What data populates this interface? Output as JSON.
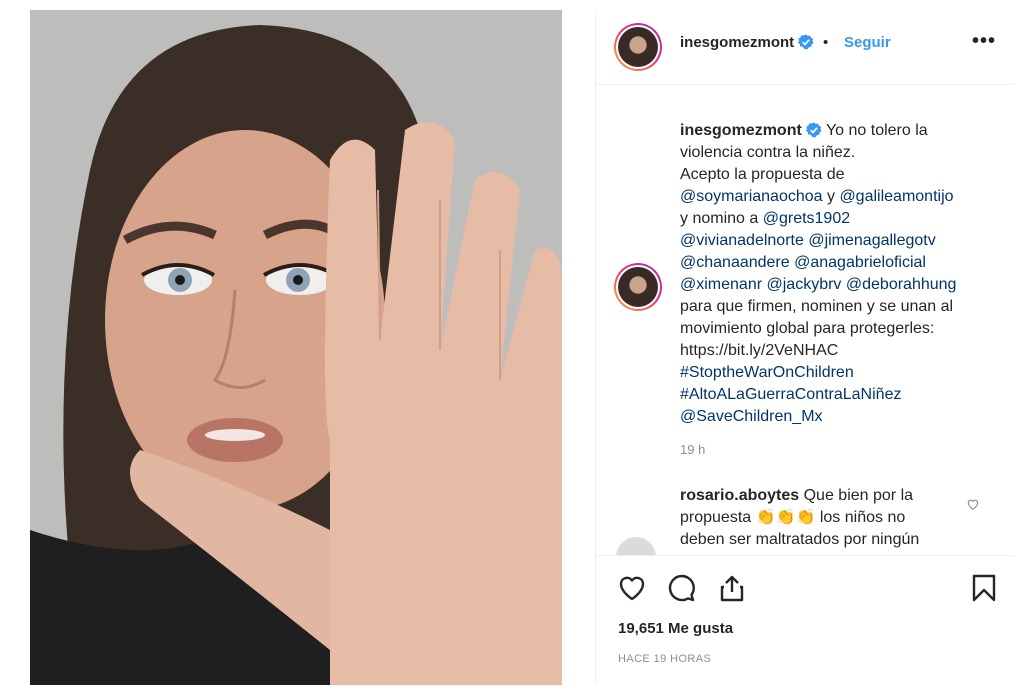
{
  "post": {
    "username": "inesgomezmont",
    "follow_label": "Seguir",
    "dot": "•",
    "more": "•••"
  },
  "caption": {
    "username": "inesgomezmont",
    "line1": "Yo no tolero la",
    "line2": "violencia contra la niñez.",
    "line3": "Acepto la propuesta de",
    "m1": "@soymarianaochoa",
    "and1": " y ",
    "m2": "@galileamontijo",
    "nom": "y nomino a ",
    "m3": "@grets1902",
    "m4": "@vivianadelnorte",
    "m5": "@jimenagallegotv",
    "m6": "@chanaandere",
    "m7": "@anagabrieloficial",
    "m8": "@ximenanr",
    "m9": "@jackybrv",
    "m10": "@deborahhung",
    "line_a": "para que firmen, nominen y se unan al",
    "line_b": "movimiento global para protegerles:",
    "link": "https://bit.ly/2VeNHAC",
    "tag1": "#StoptheWarOnChildren",
    "tag2": "#AltoALaGuerraContraLaNiñez",
    "m11": "@SaveChildren_Mx",
    "time": "19 h"
  },
  "comment": {
    "username": "rosario.aboytes",
    "text1": "Que bien por la",
    "text2": "propuesta",
    "emoji": "👏👏👏",
    "text3": "los niños no",
    "text4": "deben ser maltratados por ningún"
  },
  "stats": {
    "likes": "19,651 Me gusta",
    "ago": "HACE 19 HORAS"
  },
  "colors": {
    "link": "#003569",
    "follow": "#3897f0",
    "verified": "#3897f0"
  }
}
